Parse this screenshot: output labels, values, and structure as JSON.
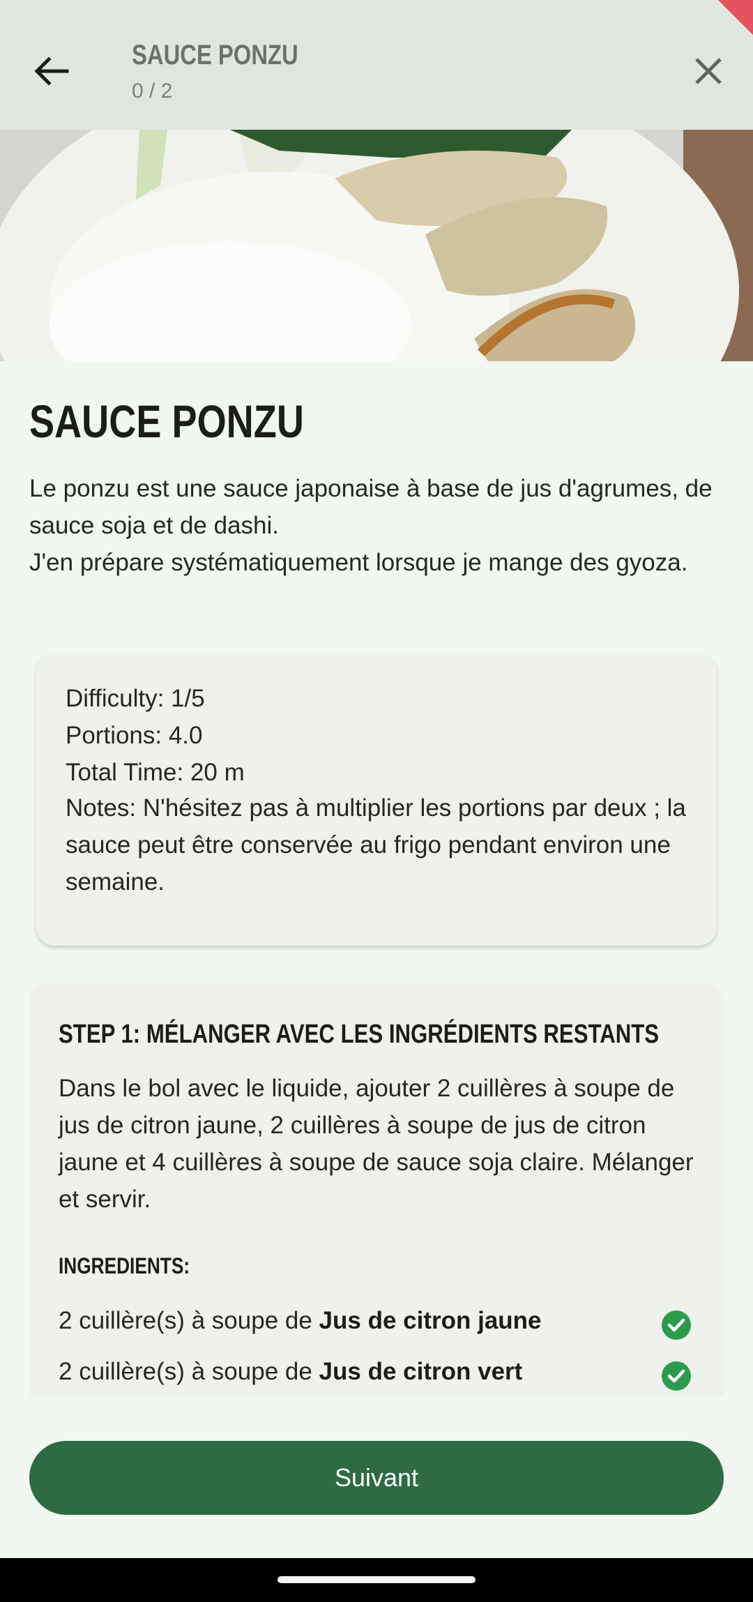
{
  "appbar": {
    "title": "SAUCE PONZU",
    "progress": "0 / 2",
    "back_icon": "arrow-back-icon",
    "close_icon": "close-icon"
  },
  "recipe": {
    "title": "SAUCE PONZU",
    "description": "Le ponzu est une sauce japonaise à base de jus d'agrumes, de sauce soja et de dashi.\nJ'en prépare systématiquement lorsque je mange des gyoza."
  },
  "info": {
    "difficulty": "Difficulty: 1/5",
    "portions": "Portions: 4.0",
    "total_time": "Total Time: 20 m",
    "notes": "Notes: N'hésitez pas à multiplier les portions par deux ; la sauce peut être conservée au frigo pendant environ une semaine."
  },
  "step": {
    "title": "STEP 1: MÉLANGER AVEC LES INGRÉDIENTS RESTANTS",
    "text": "Dans le bol avec le liquide, ajouter 2 cuillères à soupe de jus de citron jaune, 2 cuillères à soupe de jus de citron jaune et 4 cuillères à soupe de sauce soja claire. Mélanger et servir.",
    "ingredients_label": "INGREDIENTS:",
    "ingredients": [
      {
        "quantity": "2 cuillère(s) à soupe de ",
        "name": "Jus de citron jaune",
        "checked": true
      },
      {
        "quantity": "2 cuillère(s) à soupe de ",
        "name": "Jus de citron vert",
        "checked": true
      }
    ]
  },
  "footer": {
    "next_label": "Suivant"
  },
  "colors": {
    "primary": "#2d6b42",
    "check": "#2e9a4e",
    "background": "#f3f7f1",
    "card": "#eef1ec",
    "appbar": "#e1e5df",
    "ribbon": "#e0525e"
  }
}
